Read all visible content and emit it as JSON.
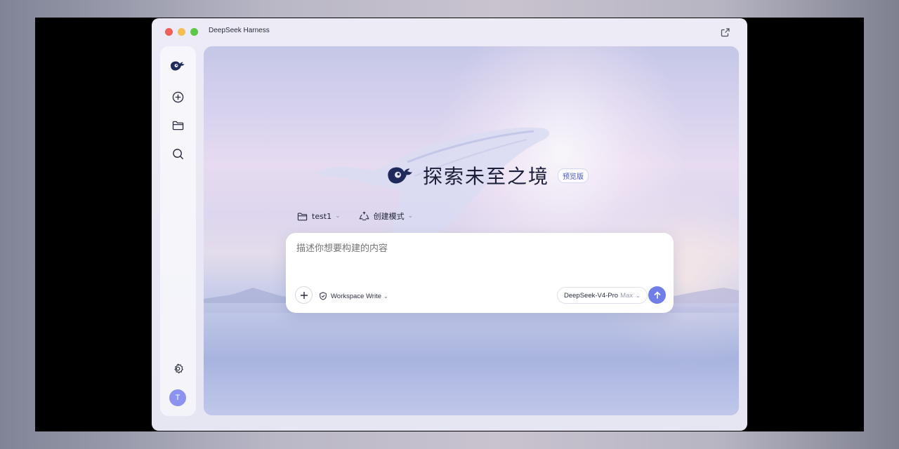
{
  "window": {
    "title": "DeepSeek Harness"
  },
  "sidebar": {
    "items": [
      {
        "name": "logo",
        "icon": "whale-logo-icon"
      },
      {
        "name": "new-chat",
        "icon": "plus-circle-icon"
      },
      {
        "name": "folder",
        "icon": "folder-icon"
      },
      {
        "name": "search",
        "icon": "search-icon"
      }
    ],
    "settings_icon": "gear-icon",
    "avatar_initial": "T"
  },
  "hero": {
    "title": "探索未至之境",
    "badge": "预览版"
  },
  "chips": {
    "project": "test1",
    "mode": "创建模式"
  },
  "composer": {
    "placeholder": "描述你想要构建的内容",
    "permission": "Workspace Write",
    "model": "DeepSeek-V4-Pro",
    "model_level": "Max"
  },
  "colors": {
    "accent": "#6f7ee8",
    "badge_text": "#4a57c8",
    "avatar": "#8b93ef"
  }
}
